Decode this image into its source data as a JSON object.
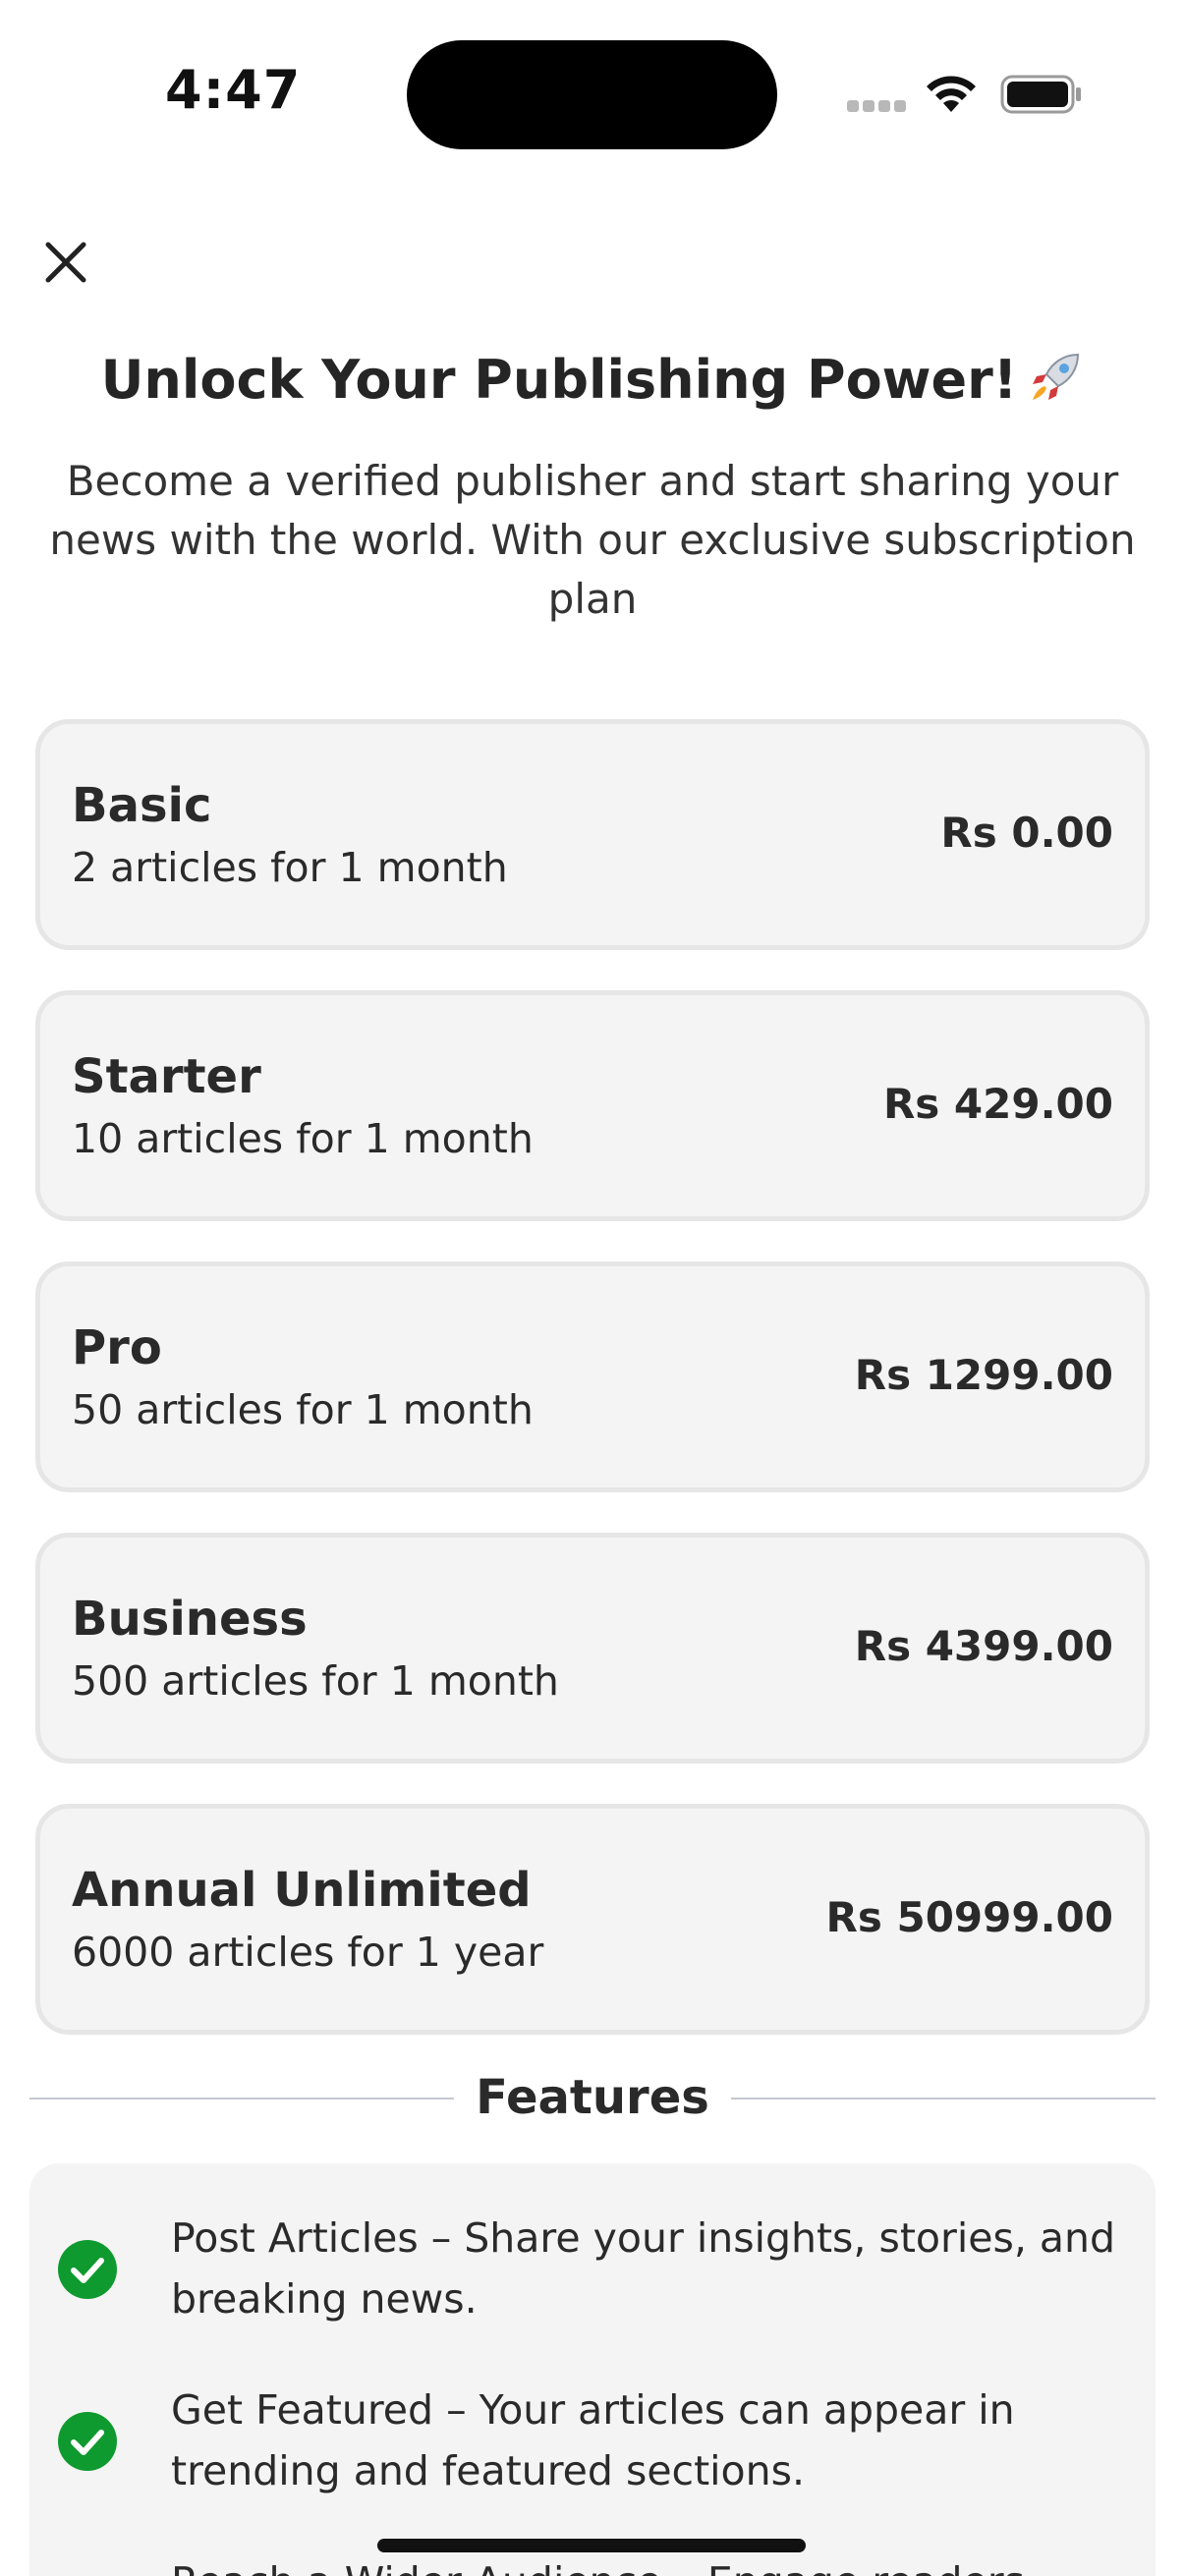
{
  "status_bar": {
    "time": "4:47"
  },
  "header": {
    "title": "Unlock Your Publishing Power!",
    "subtitle": "Become a verified publisher and start sharing your news with the world. With our exclusive subscription plan"
  },
  "plans": [
    {
      "name": "Basic",
      "description": "2 articles for 1 month",
      "price": "Rs 0.00"
    },
    {
      "name": "Starter",
      "description": "10 articles for 1 month",
      "price": "Rs 429.00"
    },
    {
      "name": "Pro",
      "description": "50 articles for 1 month",
      "price": "Rs 1299.00"
    },
    {
      "name": "Business",
      "description": "500 articles for 1 month",
      "price": "Rs 4399.00"
    },
    {
      "name": "Annual Unlimited",
      "description": "6000 articles for 1 year",
      "price": "Rs 50999.00"
    }
  ],
  "features": {
    "title": "Features",
    "items": [
      "Post Articles – Share your insights, stories, and breaking news.",
      "Get Featured – Your articles can appear in trending and featured sections.",
      "Reach a Wider Audience – Engage readers"
    ]
  },
  "colors": {
    "check_green": "#0e9a2e",
    "card_background": "#f4f4f4",
    "card_border": "#e6e6e6"
  }
}
